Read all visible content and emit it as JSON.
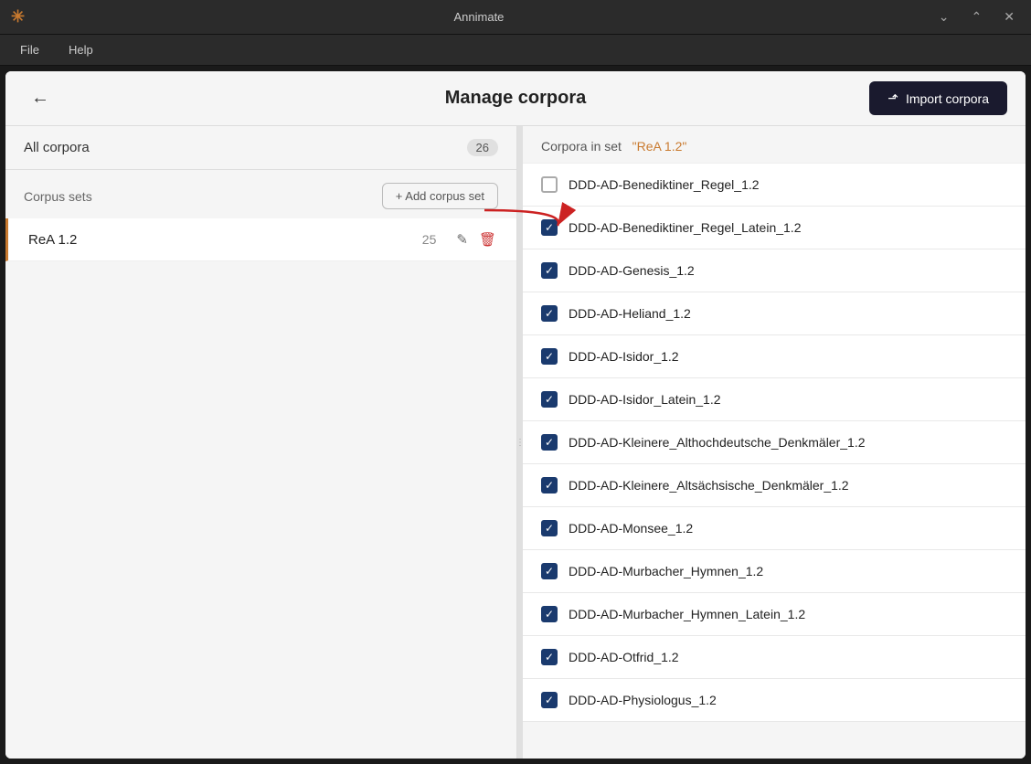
{
  "titlebar": {
    "logo": "✳",
    "title": "Annimate",
    "minimize": "⌄",
    "maximize": "⌃",
    "close": "✕"
  },
  "menubar": {
    "items": [
      "File",
      "Help"
    ]
  },
  "header": {
    "back_label": "←",
    "title": "Manage corpora",
    "import_label": "Import corpora"
  },
  "left_panel": {
    "all_corpora_label": "All corpora",
    "all_corpora_count": "26",
    "corpus_sets_label": "Corpus sets",
    "add_corpus_set_label": "+ Add corpus set",
    "sets": [
      {
        "name": "ReA 1.2",
        "count": "25"
      }
    ]
  },
  "right_panel": {
    "header_prefix": "Corpora in set",
    "set_name": "\"ReA 1.2\"",
    "items": [
      {
        "name": "DDD-AD-Benediktiner_Regel_1.2",
        "checked": false
      },
      {
        "name": "DDD-AD-Benediktiner_Regel_Latein_1.2",
        "checked": true
      },
      {
        "name": "DDD-AD-Genesis_1.2",
        "checked": true
      },
      {
        "name": "DDD-AD-Heliand_1.2",
        "checked": true
      },
      {
        "name": "DDD-AD-Isidor_1.2",
        "checked": true
      },
      {
        "name": "DDD-AD-Isidor_Latein_1.2",
        "checked": true
      },
      {
        "name": "DDD-AD-Kleinere_Althochdeutsche_Denkmäler_1.2",
        "checked": true
      },
      {
        "name": "DDD-AD-Kleinere_Altsächsische_Denkmäler_1.2",
        "checked": true
      },
      {
        "name": "DDD-AD-Monsee_1.2",
        "checked": true
      },
      {
        "name": "DDD-AD-Murbacher_Hymnen_1.2",
        "checked": true
      },
      {
        "name": "DDD-AD-Murbacher_Hymnen_Latein_1.2",
        "checked": true
      },
      {
        "name": "DDD-AD-Otfrid_1.2",
        "checked": true
      },
      {
        "name": "DDD-AD-Physiologus_1.2",
        "checked": true
      }
    ]
  }
}
